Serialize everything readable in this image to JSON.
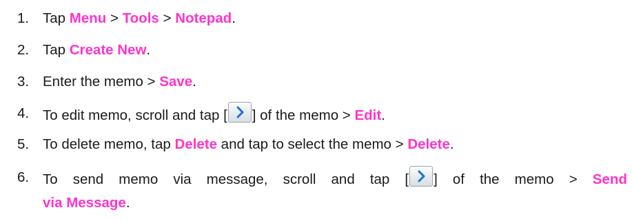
{
  "steps": [
    {
      "number": "1.",
      "parts": [
        "Tap ",
        "Menu",
        " > ",
        "Tools",
        " > ",
        "Notepad",
        "."
      ]
    },
    {
      "number": "2.",
      "parts": [
        "Tap ",
        "Create New",
        "."
      ]
    },
    {
      "number": "3.",
      "parts": [
        "Enter the memo > ",
        "Save",
        "."
      ]
    },
    {
      "number": "4.",
      "parts": [
        "To edit memo, scroll and tap [",
        "] of the memo > ",
        "Edit",
        "."
      ]
    },
    {
      "number": "5.",
      "parts": [
        "To delete memo, tap ",
        "Delete",
        " and tap to select the memo > ",
        "Delete",
        "."
      ]
    },
    {
      "number": "6.",
      "parts": [
        "To",
        "send",
        "memo",
        "via",
        "message,",
        "scroll",
        "and",
        "tap",
        "[",
        "]",
        "of",
        "the",
        "memo",
        ">",
        "Send",
        "via Message",
        "."
      ]
    }
  ],
  "colors": {
    "highlight": "#ff33cc",
    "text": "#1a1a1a",
    "icon_arrow": "#1e6fd9"
  },
  "icons": {
    "step4": "chevron-right-icon",
    "step6": "chevron-right-icon"
  }
}
